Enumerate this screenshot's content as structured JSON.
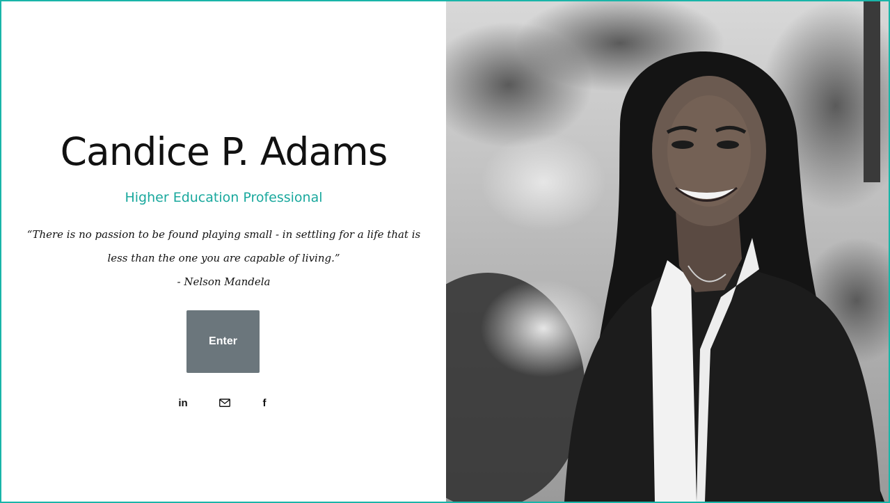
{
  "profile": {
    "name": "Candice P. Adams",
    "title": "Higher Education Professional"
  },
  "quote": {
    "line1": "“There is no passion to be found playing small - in settling for a life that is",
    "line2": "less than the one you are capable of living.”",
    "attribution": "- Nelson Mandela"
  },
  "enter_button": {
    "label": "Enter"
  },
  "social": {
    "linkedin_label": "in",
    "facebook_label": "f",
    "icons": [
      "linkedin-icon",
      "email-icon",
      "facebook-icon"
    ]
  },
  "colors": {
    "accent": "#19a89d",
    "border": "#19b5a8",
    "button": "#6b767c"
  }
}
